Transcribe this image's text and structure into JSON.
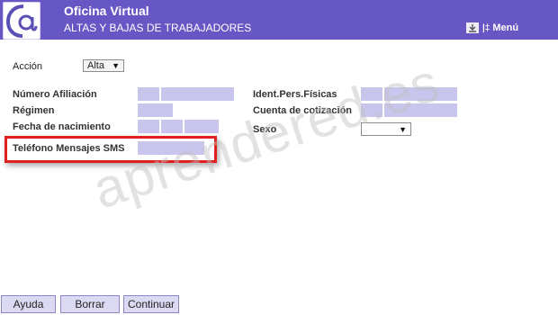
{
  "header": {
    "title": "Oficina Virtual",
    "subtitle": "ALTAS Y BAJAS DE TRABAJADORES",
    "menu_label": "Menú",
    "logo_icon": "at-sign-logo",
    "colors": {
      "bar": "#6657c4",
      "field": "#c9c6ee",
      "highlight": "#e01f1f"
    }
  },
  "form": {
    "accion_label": "Acción",
    "accion_value": "Alta",
    "numero_afiliacion_label": "Número Afiliación",
    "regimen_label": "Régimen",
    "fecha_nacimiento_label": "Fecha de nacimiento",
    "telefono_label": "Teléfono Mensajes SMS",
    "ident_label": "Ident.Pers.Físicas",
    "cuenta_label": "Cuenta de cotización",
    "sexo_label": "Sexo",
    "sexo_value": ""
  },
  "watermark": "aprendered.es",
  "buttons": {
    "ayuda": "Ayuda",
    "borrar": "Borrar",
    "continuar": "Continuar"
  }
}
